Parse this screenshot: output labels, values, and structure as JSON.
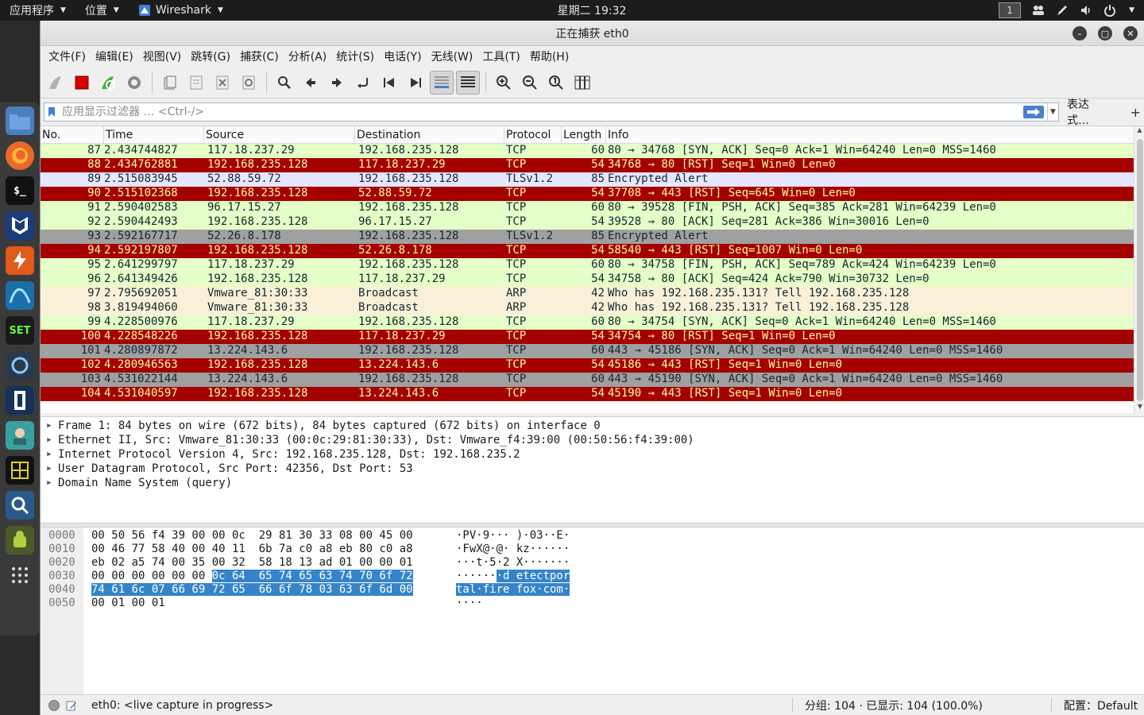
{
  "topbar": {
    "apps_label": "应用程序",
    "places_label": "位置",
    "active_app_label": "Wireshark",
    "clock": "星期二 19:32",
    "workspace": "1"
  },
  "window": {
    "title": "正在捕获 eth0"
  },
  "menu": [
    "文件(F)",
    "编辑(E)",
    "视图(V)",
    "跳转(G)",
    "捕获(C)",
    "分析(A)",
    "统计(S)",
    "电话(Y)",
    "无线(W)",
    "工具(T)",
    "帮助(H)"
  ],
  "filter": {
    "placeholder": "应用显示过滤器 … <Ctrl-/>",
    "expression_label": "表达式…",
    "add_label": "+"
  },
  "packet_list": {
    "columns": [
      "No.",
      "Time",
      "Source",
      "Destination",
      "Protocol",
      "Length",
      "Info"
    ],
    "rows": [
      {
        "no": "87",
        "time": "2.434744827",
        "src": "117.18.237.29",
        "dst": "192.168.235.128",
        "proto": "TCP",
        "len": "60",
        "info": "80 → 34768 [SYN, ACK] Seq=0 Ack=1 Win=64240 Len=0 MSS=1460",
        "style": "tcp"
      },
      {
        "no": "88",
        "time": "2.434762881",
        "src": "192.168.235.128",
        "dst": "117.18.237.29",
        "proto": "TCP",
        "len": "54",
        "info": "34768 → 80 [RST] Seq=1 Win=0 Len=0",
        "style": "rst"
      },
      {
        "no": "89",
        "time": "2.515083945",
        "src": "52.88.59.72",
        "dst": "192.168.235.128",
        "proto": "TLSv1.2",
        "len": "85",
        "info": "Encrypted Alert",
        "style": "tls"
      },
      {
        "no": "90",
        "time": "2.515102368",
        "src": "192.168.235.128",
        "dst": "52.88.59.72",
        "proto": "TCP",
        "len": "54",
        "info": "37708 → 443 [RST] Seq=645 Win=0 Len=0",
        "style": "rst"
      },
      {
        "no": "91",
        "time": "2.590402583",
        "src": "96.17.15.27",
        "dst": "192.168.235.128",
        "proto": "TCP",
        "len": "60",
        "info": "80 → 39528 [FIN, PSH, ACK] Seq=385 Ack=281 Win=64239 Len=0",
        "style": "tcp"
      },
      {
        "no": "92",
        "time": "2.590442493",
        "src": "192.168.235.128",
        "dst": "96.17.15.27",
        "proto": "TCP",
        "len": "54",
        "info": "39528 → 80 [ACK] Seq=281 Ack=386 Win=30016 Len=0",
        "style": "tcp"
      },
      {
        "no": "93",
        "time": "2.592167717",
        "src": "52.26.8.178",
        "dst": "192.168.235.128",
        "proto": "TLSv1.2",
        "len": "85",
        "info": "Encrypted Alert",
        "style": "grey"
      },
      {
        "no": "94",
        "time": "2.592197807",
        "src": "192.168.235.128",
        "dst": "52.26.8.178",
        "proto": "TCP",
        "len": "54",
        "info": "58540 → 443 [RST] Seq=1007 Win=0 Len=0",
        "style": "rst"
      },
      {
        "no": "95",
        "time": "2.641299797",
        "src": "117.18.237.29",
        "dst": "192.168.235.128",
        "proto": "TCP",
        "len": "60",
        "info": "80 → 34758 [FIN, PSH, ACK] Seq=789 Ack=424 Win=64239 Len=0",
        "style": "tcp"
      },
      {
        "no": "96",
        "time": "2.641349426",
        "src": "192.168.235.128",
        "dst": "117.18.237.29",
        "proto": "TCP",
        "len": "54",
        "info": "34758 → 80 [ACK] Seq=424 Ack=790 Win=30732 Len=0",
        "style": "tcp"
      },
      {
        "no": "97",
        "time": "2.795692051",
        "src": "Vmware_81:30:33",
        "dst": "Broadcast",
        "proto": "ARP",
        "len": "42",
        "info": "Who has 192.168.235.131? Tell 192.168.235.128",
        "style": "arp"
      },
      {
        "no": "98",
        "time": "3.819494060",
        "src": "Vmware_81:30:33",
        "dst": "Broadcast",
        "proto": "ARP",
        "len": "42",
        "info": "Who has 192.168.235.131? Tell 192.168.235.128",
        "style": "arp"
      },
      {
        "no": "99",
        "time": "4.228500976",
        "src": "117.18.237.29",
        "dst": "192.168.235.128",
        "proto": "TCP",
        "len": "60",
        "info": "80 → 34754 [SYN, ACK] Seq=0 Ack=1 Win=64240 Len=0 MSS=1460",
        "style": "tcp"
      },
      {
        "no": "100",
        "time": "4.228548226",
        "src": "192.168.235.128",
        "dst": "117.18.237.29",
        "proto": "TCP",
        "len": "54",
        "info": "34754 → 80 [RST] Seq=1 Win=0 Len=0",
        "style": "rst"
      },
      {
        "no": "101",
        "time": "4.280897872",
        "src": "13.224.143.6",
        "dst": "192.168.235.128",
        "proto": "TCP",
        "len": "60",
        "info": "443 → 45186 [SYN, ACK] Seq=0 Ack=1 Win=64240 Len=0 MSS=1460",
        "style": "grey"
      },
      {
        "no": "102",
        "time": "4.280946563",
        "src": "192.168.235.128",
        "dst": "13.224.143.6",
        "proto": "TCP",
        "len": "54",
        "info": "45186 → 443 [RST] Seq=1 Win=0 Len=0",
        "style": "rst"
      },
      {
        "no": "103",
        "time": "4.531022144",
        "src": "13.224.143.6",
        "dst": "192.168.235.128",
        "proto": "TCP",
        "len": "60",
        "info": "443 → 45190 [SYN, ACK] Seq=0 Ack=1 Win=64240 Len=0 MSS=1460",
        "style": "grey"
      },
      {
        "no": "104",
        "time": "4.531040597",
        "src": "192.168.235.128",
        "dst": "13.224.143.6",
        "proto": "TCP",
        "len": "54",
        "info": "45190 → 443 [RST] Seq=1 Win=0 Len=0",
        "style": "rst"
      }
    ]
  },
  "details": [
    "Frame 1: 84 bytes on wire (672 bits), 84 bytes captured (672 bits) on interface 0",
    "Ethernet II, Src: Vmware_81:30:33 (00:0c:29:81:30:33), Dst: Vmware_f4:39:00 (00:50:56:f4:39:00)",
    "Internet Protocol Version 4, Src: 192.168.235.128, Dst: 192.168.235.2",
    "User Datagram Protocol, Src Port: 42356, Dst Port: 53",
    "Domain Name System (query)"
  ],
  "bytes": [
    {
      "off": "0000",
      "hex_a": "00 50 56 f4 39 00 00 0c  29 81 30 33 08 00 45 00",
      "hex_hl": "",
      "asc_a": "·PV·9··· )·03··E·",
      "asc_hl": ""
    },
    {
      "off": "0010",
      "hex_a": "00 46 77 58 40 00 40 11  6b 7a c0 a8 eb 80 c0 a8",
      "hex_hl": "",
      "asc_a": "·FwX@·@· kz······",
      "asc_hl": ""
    },
    {
      "off": "0020",
      "hex_a": "eb 02 a5 74 00 35 00 32  58 18 13 ad 01 00 00 01",
      "hex_hl": "",
      "asc_a": "···t·5·2 X·······",
      "asc_hl": ""
    },
    {
      "off": "0030",
      "hex_a": "00 00 00 00 00 00 ",
      "hex_hl": "0c 64  65 74 65 63 74 70 6f 72",
      "asc_a": "······",
      "asc_hl": "·d etectpor"
    },
    {
      "off": "0040",
      "hex_a": "",
      "hex_hl": "74 61 6c 07 66 69 72 65  66 6f 78 03 63 6f 6d 00",
      "asc_a": "",
      "asc_hl": "tal·fire fox·com·"
    },
    {
      "off": "0050",
      "hex_a": "00 01 00 01",
      "hex_hl": "",
      "asc_a": "····",
      "asc_hl": ""
    }
  ],
  "status": {
    "capture_text": "eth0: <live capture in progress>",
    "packets_text": "分组: 104 · 已显示: 104 (100.0%)",
    "profile_text": "配置：Default"
  },
  "colors": {
    "tcp_row": "#e4ffc7",
    "rst_row": "#a40000",
    "tls_row": "#e7e6ff",
    "grey_row": "#a0a0a0",
    "arp_row": "#faf0d7",
    "selection": "#3584c9"
  }
}
